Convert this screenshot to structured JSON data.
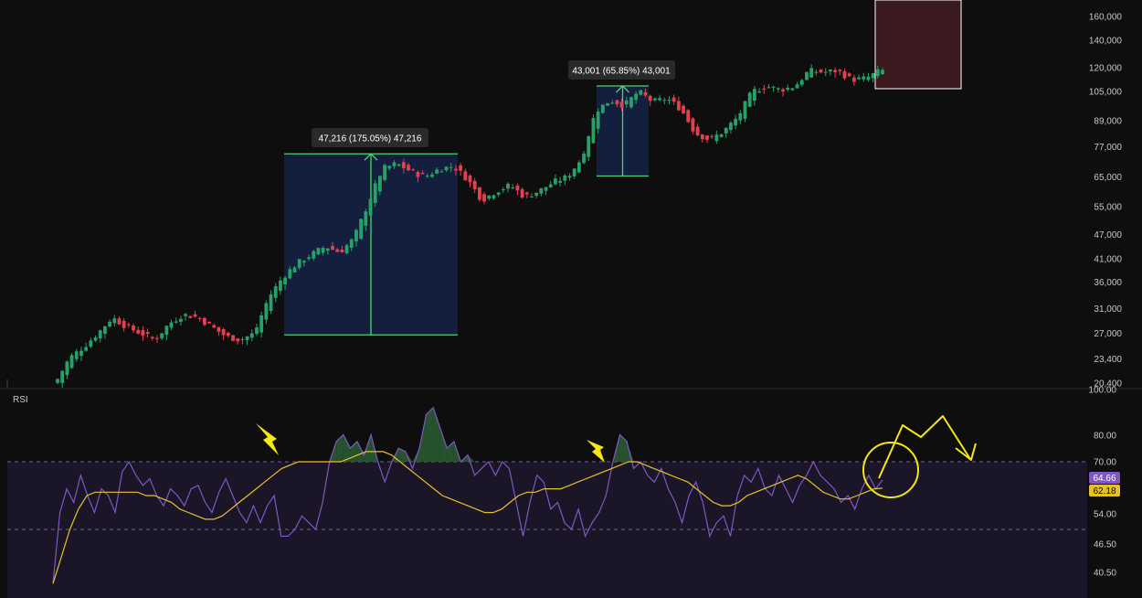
{
  "colors": {
    "background": "#0e0e0e",
    "up_candle": "#26a269",
    "down_candle": "#e5404f",
    "measure_box_fill": "#14213f",
    "measure_box_line": "#4fd07a",
    "rsi_line": "#7e57c2",
    "rsi_ma": "#e6c229",
    "rsi_band": "#1a1628",
    "annotation": "#f5e616",
    "target_box": "#3a1a1e",
    "target_box_border": "#ffffff",
    "rsi_badge": "#7e57c2",
    "ma_badge": "#e6c229"
  },
  "rsi_panel": {
    "label": "RSI",
    "current_rsi": "64.66",
    "current_ma": "62.18"
  },
  "measurements": [
    {
      "label": "47,216 (175.05%) 47,216"
    },
    {
      "label": "43,001 (65.85%) 43,001"
    }
  ],
  "chart_data": [
    {
      "type": "candlestick",
      "yscale": "log",
      "ylim": [
        20400,
        160000
      ],
      "yticks": [
        160000,
        140000,
        120000,
        105000,
        89000,
        77000,
        65000,
        55000,
        47000,
        41000,
        36000,
        31000,
        27000,
        23400,
        20400
      ],
      "ytick_labels": [
        "160,000",
        "140,000",
        "120,000",
        "105,000",
        "89,000",
        "77,000",
        "65,000",
        "55,000",
        "47,000",
        "41,000",
        "36,000",
        "31,000",
        "27,000",
        "23,400",
        "20,400"
      ],
      "price_trend": [
        [
          0,
          20400
        ],
        [
          3,
          23500
        ],
        [
          6,
          25000
        ],
        [
          9,
          27000
        ],
        [
          12,
          29500
        ],
        [
          15,
          28000
        ],
        [
          18,
          27000
        ],
        [
          21,
          26000
        ],
        [
          24,
          28500
        ],
        [
          27,
          30000
        ],
        [
          30,
          29500
        ],
        [
          33,
          28000
        ],
        [
          36,
          26500
        ],
        [
          39,
          26000
        ],
        [
          42,
          27000
        ],
        [
          45,
          33000
        ],
        [
          48,
          37000
        ],
        [
          51,
          40000
        ],
        [
          54,
          42000
        ],
        [
          57,
          44000
        ],
        [
          60,
          42500
        ],
        [
          63,
          46000
        ],
        [
          66,
          56000
        ],
        [
          69,
          68000
        ],
        [
          72,
          70000
        ],
        [
          75,
          67000
        ],
        [
          78,
          65000
        ],
        [
          81,
          68000
        ],
        [
          84,
          69000
        ],
        [
          87,
          64000
        ],
        [
          90,
          57000
        ],
        [
          93,
          60000
        ],
        [
          96,
          62000
        ],
        [
          99,
          58000
        ],
        [
          102,
          60000
        ],
        [
          105,
          63000
        ],
        [
          108,
          65000
        ],
        [
          111,
          72000
        ],
        [
          114,
          94000
        ],
        [
          117,
          100000
        ],
        [
          120,
          97000
        ],
        [
          123,
          105000
        ],
        [
          126,
          99000
        ],
        [
          129,
          101000
        ],
        [
          132,
          95000
        ],
        [
          135,
          83000
        ],
        [
          138,
          80000
        ],
        [
          141,
          84000
        ],
        [
          144,
          91000
        ],
        [
          147,
          105000
        ],
        [
          150,
          108000
        ],
        [
          153,
          106000
        ],
        [
          156,
          108000
        ],
        [
          159,
          118000
        ],
        [
          162,
          117000
        ],
        [
          165,
          118000
        ],
        [
          168,
          112000
        ],
        [
          171,
          113000
        ],
        [
          174,
          118000
        ]
      ],
      "measurements": [
        {
          "from": 26750,
          "to": 73966,
          "change": 47216,
          "percent": 175.05
        },
        {
          "from": 65300,
          "to": 108301,
          "change": 43001,
          "percent": 65.85
        }
      ],
      "target_zone": {
        "low": 108000,
        "high": 160000
      }
    },
    {
      "type": "line",
      "title": "RSI",
      "ylim": [
        34,
        100
      ],
      "yticks": [
        100,
        80,
        70,
        54,
        46.5,
        40.5
      ],
      "ytick_labels": [
        "100.00",
        "80.00",
        "70.00",
        "54.00",
        "46.50",
        "40.50"
      ],
      "bands": [
        70,
        50
      ],
      "series": [
        {
          "values": [
            34,
            55,
            62,
            58,
            66,
            60,
            55,
            62,
            60,
            55,
            67,
            70,
            66,
            63,
            65,
            60,
            57,
            62,
            60,
            57,
            62,
            63,
            58,
            55,
            61,
            65,
            60,
            55,
            52,
            57,
            52,
            57,
            60,
            48,
            48,
            50,
            54,
            52,
            50,
            58,
            70,
            76,
            78,
            74,
            76,
            72,
            78,
            70,
            64,
            70,
            74,
            73,
            68,
            74,
            84,
            86,
            80,
            74,
            76,
            70,
            72,
            66,
            68,
            70,
            66,
            70,
            68,
            58,
            48,
            58,
            66,
            64,
            56,
            58,
            52,
            50,
            56,
            48,
            52,
            55,
            60,
            70,
            78,
            76,
            68,
            70,
            66,
            64,
            68,
            62,
            58,
            52,
            60,
            64,
            58,
            48,
            52,
            54,
            48,
            60,
            66,
            64,
            68,
            62,
            60,
            66,
            62,
            58,
            63,
            66,
            70,
            66,
            64,
            62,
            58,
            60,
            56,
            62,
            66,
            62,
            64.66
          ]
        },
        {
          "values": [
            34,
            42,
            50,
            56,
            60,
            61,
            61,
            61,
            61,
            61,
            61,
            60,
            60,
            59,
            58,
            56,
            55,
            54,
            53,
            53,
            54,
            56,
            58,
            60,
            62,
            64,
            66,
            68,
            69,
            70,
            70,
            70,
            70,
            70,
            70,
            71,
            72,
            73,
            73,
            73,
            72,
            70,
            68,
            66,
            64,
            62,
            60,
            59,
            58,
            57,
            56,
            55,
            55,
            56,
            58,
            60,
            61,
            61,
            62,
            62,
            62,
            63,
            64,
            65,
            66,
            67,
            68,
            69,
            70,
            70,
            69,
            68,
            67,
            66,
            65,
            64,
            62,
            60,
            58,
            57,
            57,
            58,
            60,
            61,
            62,
            63,
            64,
            65,
            66,
            65,
            63,
            61,
            60,
            59,
            59,
            60,
            61,
            62,
            62.18
          ]
        }
      ]
    }
  ]
}
